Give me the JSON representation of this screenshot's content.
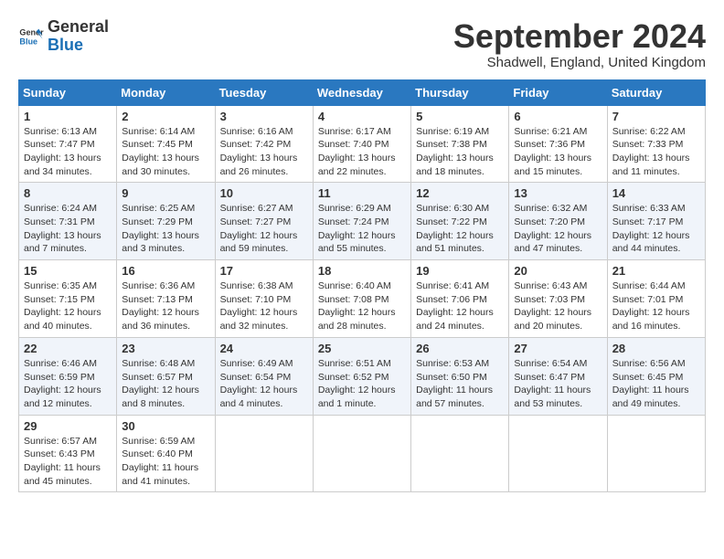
{
  "header": {
    "logo_line1": "General",
    "logo_line2": "Blue",
    "month": "September 2024",
    "location": "Shadwell, England, United Kingdom"
  },
  "weekdays": [
    "Sunday",
    "Monday",
    "Tuesday",
    "Wednesday",
    "Thursday",
    "Friday",
    "Saturday"
  ],
  "weeks": [
    [
      {
        "day": "1",
        "lines": [
          "Sunrise: 6:13 AM",
          "Sunset: 7:47 PM",
          "Daylight: 13 hours",
          "and 34 minutes."
        ]
      },
      {
        "day": "2",
        "lines": [
          "Sunrise: 6:14 AM",
          "Sunset: 7:45 PM",
          "Daylight: 13 hours",
          "and 30 minutes."
        ]
      },
      {
        "day": "3",
        "lines": [
          "Sunrise: 6:16 AM",
          "Sunset: 7:42 PM",
          "Daylight: 13 hours",
          "and 26 minutes."
        ]
      },
      {
        "day": "4",
        "lines": [
          "Sunrise: 6:17 AM",
          "Sunset: 7:40 PM",
          "Daylight: 13 hours",
          "and 22 minutes."
        ]
      },
      {
        "day": "5",
        "lines": [
          "Sunrise: 6:19 AM",
          "Sunset: 7:38 PM",
          "Daylight: 13 hours",
          "and 18 minutes."
        ]
      },
      {
        "day": "6",
        "lines": [
          "Sunrise: 6:21 AM",
          "Sunset: 7:36 PM",
          "Daylight: 13 hours",
          "and 15 minutes."
        ]
      },
      {
        "day": "7",
        "lines": [
          "Sunrise: 6:22 AM",
          "Sunset: 7:33 PM",
          "Daylight: 13 hours",
          "and 11 minutes."
        ]
      }
    ],
    [
      {
        "day": "8",
        "lines": [
          "Sunrise: 6:24 AM",
          "Sunset: 7:31 PM",
          "Daylight: 13 hours",
          "and 7 minutes."
        ]
      },
      {
        "day": "9",
        "lines": [
          "Sunrise: 6:25 AM",
          "Sunset: 7:29 PM",
          "Daylight: 13 hours",
          "and 3 minutes."
        ]
      },
      {
        "day": "10",
        "lines": [
          "Sunrise: 6:27 AM",
          "Sunset: 7:27 PM",
          "Daylight: 12 hours",
          "and 59 minutes."
        ]
      },
      {
        "day": "11",
        "lines": [
          "Sunrise: 6:29 AM",
          "Sunset: 7:24 PM",
          "Daylight: 12 hours",
          "and 55 minutes."
        ]
      },
      {
        "day": "12",
        "lines": [
          "Sunrise: 6:30 AM",
          "Sunset: 7:22 PM",
          "Daylight: 12 hours",
          "and 51 minutes."
        ]
      },
      {
        "day": "13",
        "lines": [
          "Sunrise: 6:32 AM",
          "Sunset: 7:20 PM",
          "Daylight: 12 hours",
          "and 47 minutes."
        ]
      },
      {
        "day": "14",
        "lines": [
          "Sunrise: 6:33 AM",
          "Sunset: 7:17 PM",
          "Daylight: 12 hours",
          "and 44 minutes."
        ]
      }
    ],
    [
      {
        "day": "15",
        "lines": [
          "Sunrise: 6:35 AM",
          "Sunset: 7:15 PM",
          "Daylight: 12 hours",
          "and 40 minutes."
        ]
      },
      {
        "day": "16",
        "lines": [
          "Sunrise: 6:36 AM",
          "Sunset: 7:13 PM",
          "Daylight: 12 hours",
          "and 36 minutes."
        ]
      },
      {
        "day": "17",
        "lines": [
          "Sunrise: 6:38 AM",
          "Sunset: 7:10 PM",
          "Daylight: 12 hours",
          "and 32 minutes."
        ]
      },
      {
        "day": "18",
        "lines": [
          "Sunrise: 6:40 AM",
          "Sunset: 7:08 PM",
          "Daylight: 12 hours",
          "and 28 minutes."
        ]
      },
      {
        "day": "19",
        "lines": [
          "Sunrise: 6:41 AM",
          "Sunset: 7:06 PM",
          "Daylight: 12 hours",
          "and 24 minutes."
        ]
      },
      {
        "day": "20",
        "lines": [
          "Sunrise: 6:43 AM",
          "Sunset: 7:03 PM",
          "Daylight: 12 hours",
          "and 20 minutes."
        ]
      },
      {
        "day": "21",
        "lines": [
          "Sunrise: 6:44 AM",
          "Sunset: 7:01 PM",
          "Daylight: 12 hours",
          "and 16 minutes."
        ]
      }
    ],
    [
      {
        "day": "22",
        "lines": [
          "Sunrise: 6:46 AM",
          "Sunset: 6:59 PM",
          "Daylight: 12 hours",
          "and 12 minutes."
        ]
      },
      {
        "day": "23",
        "lines": [
          "Sunrise: 6:48 AM",
          "Sunset: 6:57 PM",
          "Daylight: 12 hours",
          "and 8 minutes."
        ]
      },
      {
        "day": "24",
        "lines": [
          "Sunrise: 6:49 AM",
          "Sunset: 6:54 PM",
          "Daylight: 12 hours",
          "and 4 minutes."
        ]
      },
      {
        "day": "25",
        "lines": [
          "Sunrise: 6:51 AM",
          "Sunset: 6:52 PM",
          "Daylight: 12 hours",
          "and 1 minute."
        ]
      },
      {
        "day": "26",
        "lines": [
          "Sunrise: 6:53 AM",
          "Sunset: 6:50 PM",
          "Daylight: 11 hours",
          "and 57 minutes."
        ]
      },
      {
        "day": "27",
        "lines": [
          "Sunrise: 6:54 AM",
          "Sunset: 6:47 PM",
          "Daylight: 11 hours",
          "and 53 minutes."
        ]
      },
      {
        "day": "28",
        "lines": [
          "Sunrise: 6:56 AM",
          "Sunset: 6:45 PM",
          "Daylight: 11 hours",
          "and 49 minutes."
        ]
      }
    ],
    [
      {
        "day": "29",
        "lines": [
          "Sunrise: 6:57 AM",
          "Sunset: 6:43 PM",
          "Daylight: 11 hours",
          "and 45 minutes."
        ]
      },
      {
        "day": "30",
        "lines": [
          "Sunrise: 6:59 AM",
          "Sunset: 6:40 PM",
          "Daylight: 11 hours",
          "and 41 minutes."
        ]
      },
      {
        "day": "",
        "lines": []
      },
      {
        "day": "",
        "lines": []
      },
      {
        "day": "",
        "lines": []
      },
      {
        "day": "",
        "lines": []
      },
      {
        "day": "",
        "lines": []
      }
    ]
  ]
}
